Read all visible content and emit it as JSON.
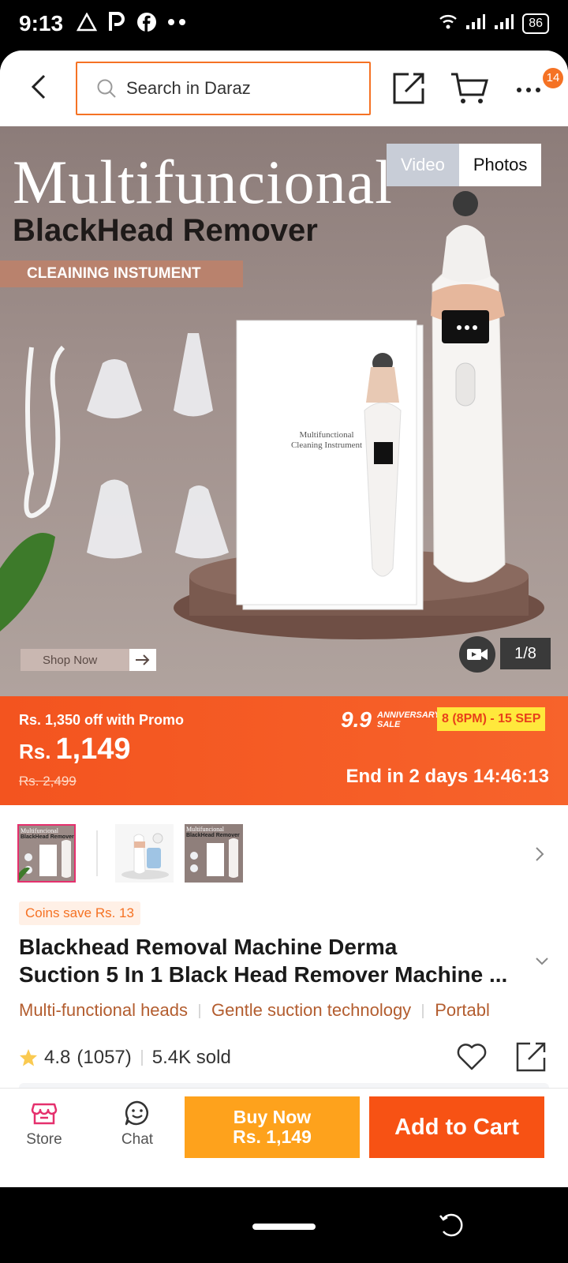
{
  "status_bar": {
    "time": "9:13",
    "battery": "86",
    "left_icons": [
      "warning-triangle-icon",
      "parking-p-icon",
      "facebook-icon",
      "dots-icon"
    ],
    "right_icons": [
      "wifi-icon",
      "signal-icon",
      "signal-icon",
      "battery-icon"
    ]
  },
  "header": {
    "search_placeholder": "Search in Daraz",
    "more_badge": "14",
    "accent_color": "#f57224"
  },
  "hero": {
    "title_line1": "Multifuncional",
    "title_line2": "BlackHead Remover",
    "pill": "CLEAINING INSTUMENT",
    "box_text_line1": "Multifunctional",
    "box_text_line2": "Cleaning Instrument",
    "shop_now": "Shop Now",
    "tab_video": "Video",
    "tab_photos": "Photos",
    "page_counter": "1/8"
  },
  "promo": {
    "off_text": "Rs. 1,350 off with Promo",
    "currency": "Rs.",
    "price": "1,149",
    "original_price": "Rs. 2,499",
    "sale_logo": "9.9",
    "sale_sub_line1": "ANNIVERSARY",
    "sale_sub_line2": "SALE",
    "sale_date": "8 (8PM) - 15 SEP",
    "ends_in": "End in 2 days 14:46:13",
    "band_color": "#f3541f"
  },
  "thumbnails": {
    "thumb1_line1": "Multifuncional",
    "thumb1_line2": "BlackHead Remover",
    "thumb3_line1": "Multifuncional",
    "thumb3_line2": "BlackHead Remover"
  },
  "product": {
    "coins": "Coins save Rs. 13",
    "title_line1": "Blackhead Removal Machine Derma",
    "title_line2": "Suction 5 In 1 Black Head Remover Machine ...",
    "features": [
      "Multi-functional heads",
      "Gentle suction technology",
      "Portabl"
    ],
    "rating": "4.8",
    "reviews": "(1057)",
    "sold": "5.4K sold"
  },
  "bottom_bar": {
    "store": "Store",
    "chat": "Chat",
    "buy_now": "Buy Now",
    "buy_price": "Rs. 1,149",
    "add_to_cart": "Add to Cart",
    "buy_color": "#fea21c",
    "cart_color": "#f75214"
  }
}
